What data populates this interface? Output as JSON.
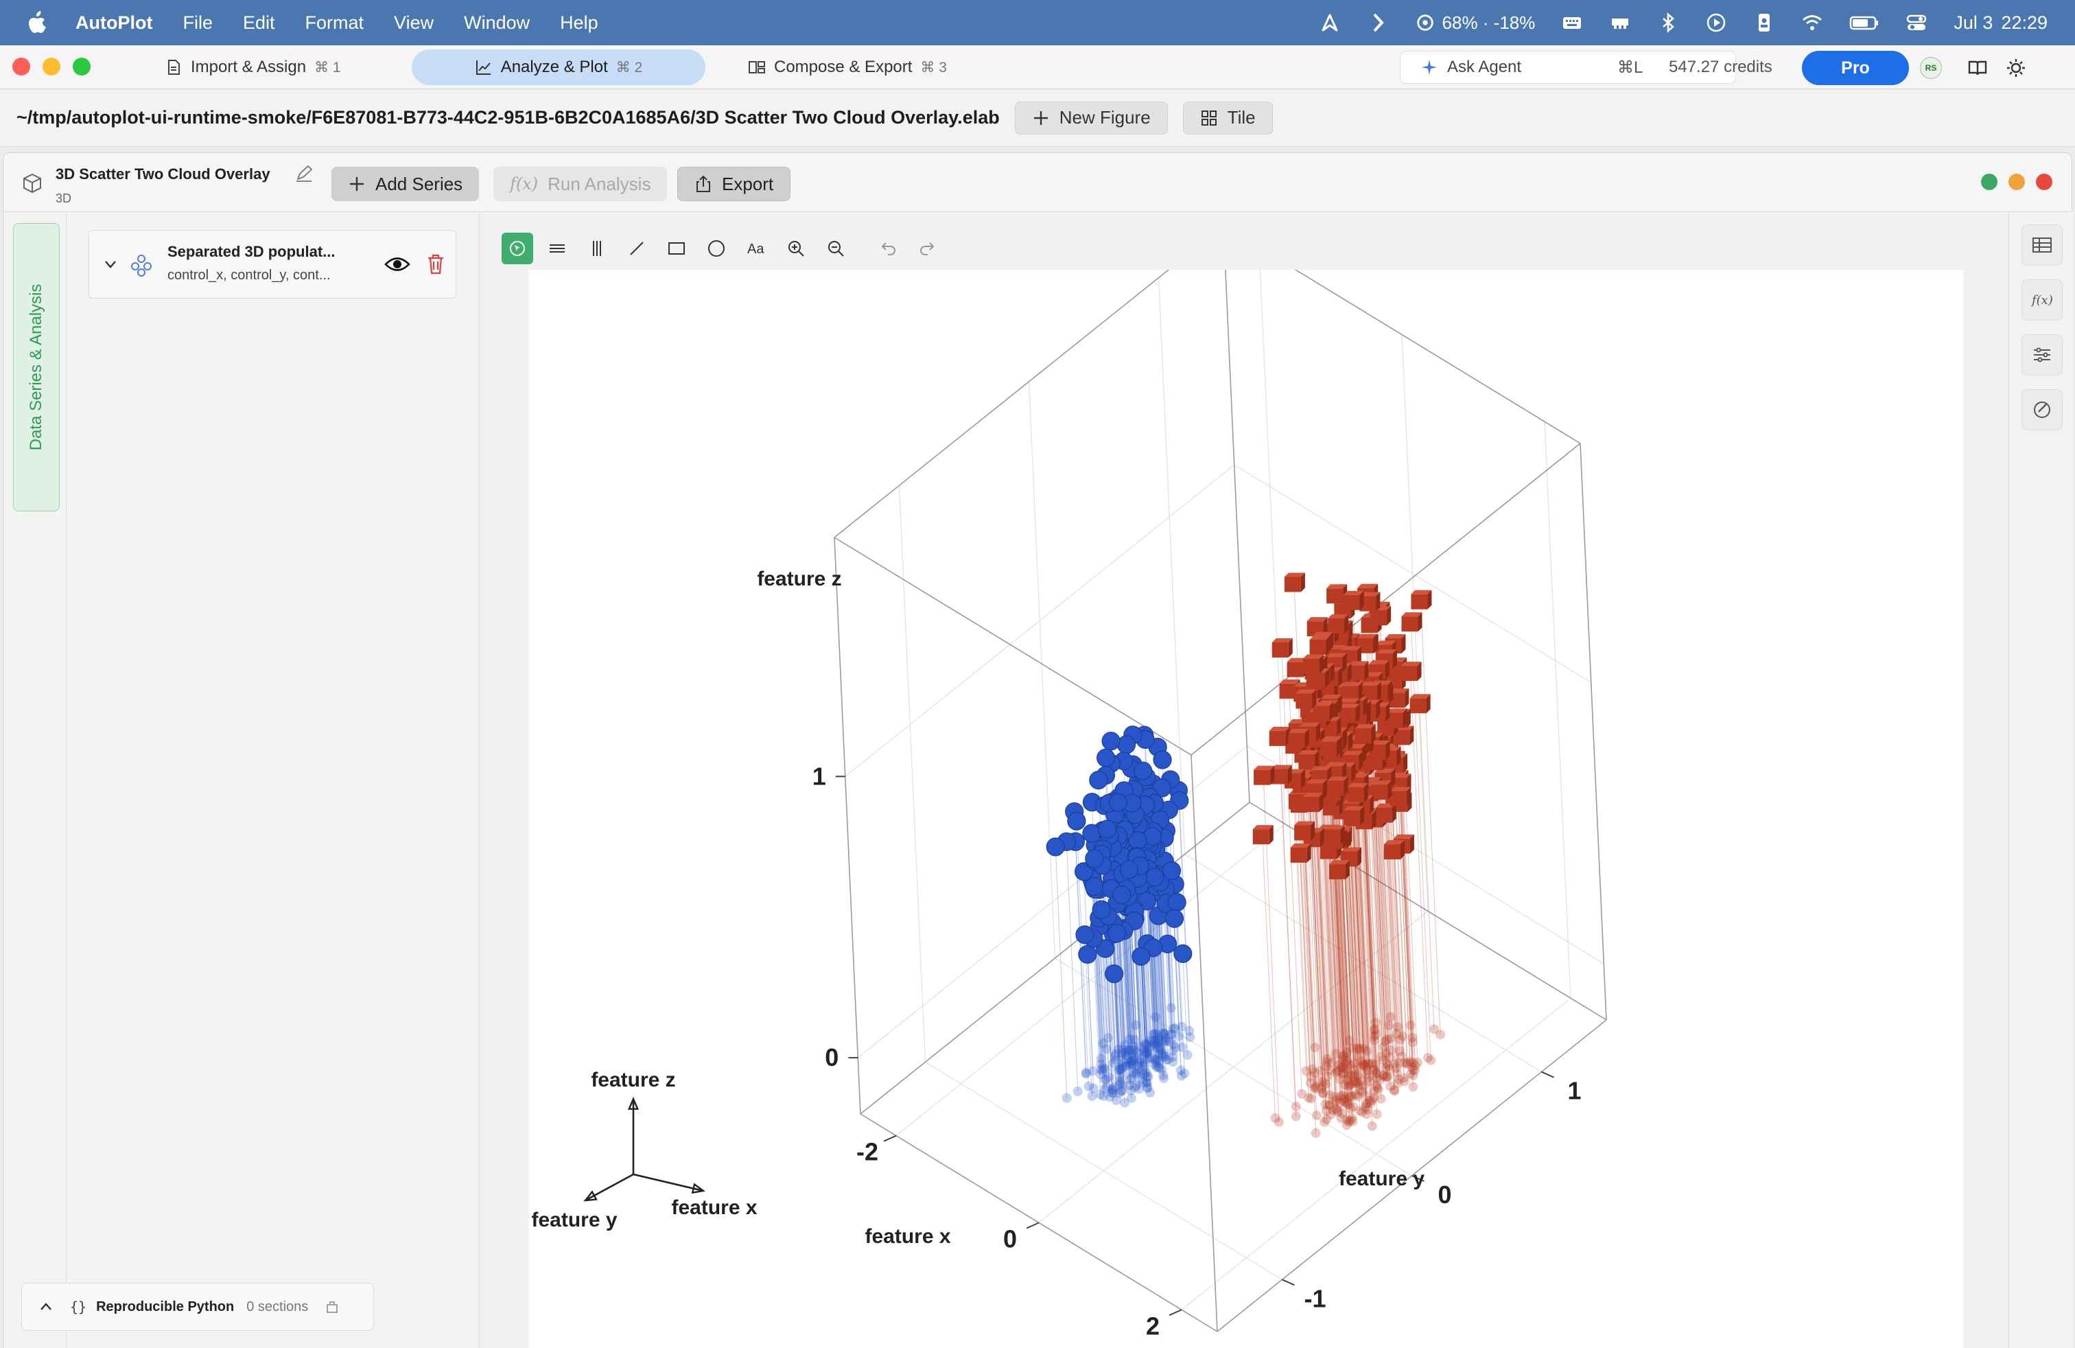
{
  "menubar": {
    "app_name": "AutoPlot",
    "items": [
      "File",
      "Edit",
      "Format",
      "View",
      "Window",
      "Help"
    ],
    "battery": "68% · -18%",
    "date": "Jul 3",
    "time": "22:29"
  },
  "tabs": [
    {
      "label": "Import & Assign",
      "shortcut": "⌘ 1"
    },
    {
      "label": "Analyze & Plot",
      "shortcut": "⌘ 2"
    },
    {
      "label": "Compose & Export",
      "shortcut": "⌘ 3"
    }
  ],
  "agent": {
    "label": "Ask Agent",
    "shortcut": "⌘L",
    "credits": "547.27 credits"
  },
  "pro_label": "Pro",
  "avatar_initials": "RS",
  "pathbar": {
    "path": "~/tmp/autoplot-ui-runtime-smoke/F6E87081-B773-44C2-951B-6B2C0A1685A6/3D Scatter Two Cloud Overlay.elab",
    "new_figure": "New Figure",
    "tile": "Tile"
  },
  "figure": {
    "title": "3D Scatter Two Cloud Overlay",
    "subtitle": "3D",
    "add_series": "Add Series",
    "run_analysis": "Run Analysis",
    "export": "Export"
  },
  "sidebar_tab": "Data Series & Analysis",
  "series": {
    "name": "Separated 3D populat...",
    "columns": "control_x, control_y, cont..."
  },
  "python_bar": {
    "label": "Reproducible Python",
    "sections": "0 sections"
  },
  "colors": {
    "blue_series": "#2856c8",
    "red_series": "#b83a22",
    "accent": "#1e6ee8",
    "green": "#3fae6c"
  },
  "chart_data": {
    "type": "scatter",
    "axes": {
      "x": {
        "label": "feature x",
        "ticks": [
          "-2",
          "0",
          "2"
        ]
      },
      "y": {
        "label": "feature y",
        "ticks": [
          "-1",
          "0",
          "1"
        ]
      },
      "z": {
        "label": "feature z",
        "ticks": [
          "0",
          "1"
        ]
      }
    },
    "orientation_axes": {
      "x": "feature x",
      "y": "feature y",
      "z": "feature z"
    },
    "series": [
      {
        "marker": "sphere",
        "color": "#2856c8",
        "x_range": [
          -1.4,
          -0.2
        ],
        "y_range": [
          -0.8,
          0.2
        ],
        "z_range": [
          0.1,
          1.0
        ]
      },
      {
        "marker": "cube",
        "color": "#b83a22",
        "x_range": [
          0.3,
          1.9
        ],
        "y_range": [
          -0.3,
          1.0
        ],
        "z_range": [
          0.5,
          1.6
        ]
      }
    ],
    "grid": true
  }
}
